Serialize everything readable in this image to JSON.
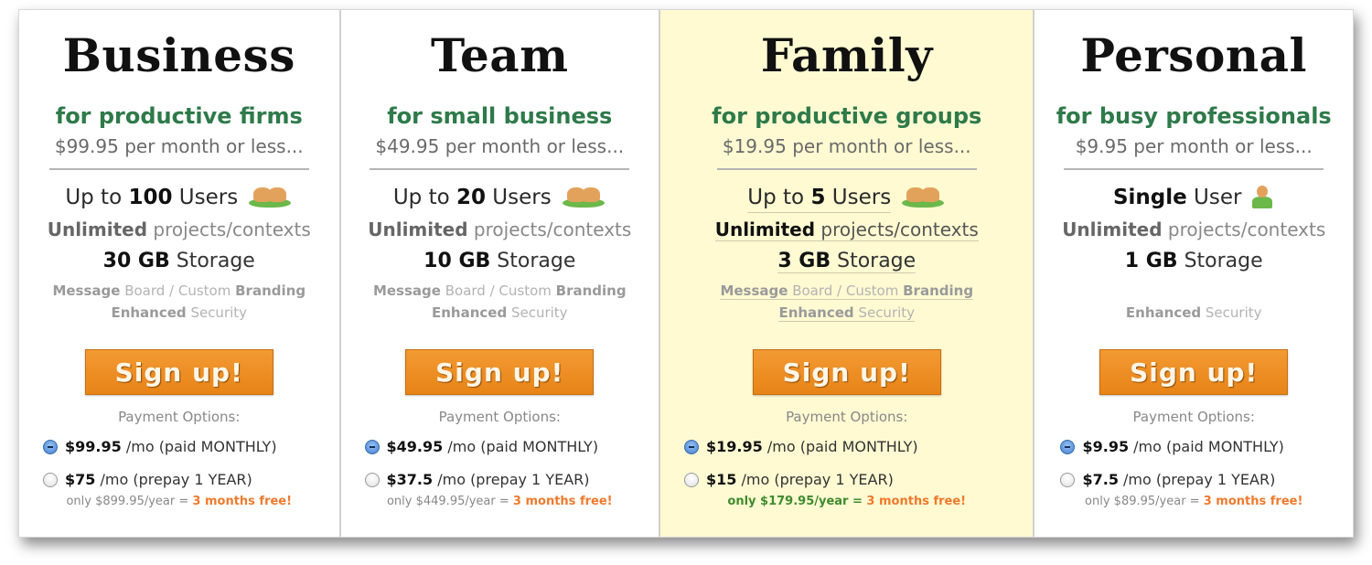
{
  "plans": [
    {
      "name": "Business",
      "tagline": "for productive firms",
      "price_line": "$99.95 per month or less...",
      "users_prefix": "Up to ",
      "users_count": "100",
      "users_suffix": " Users",
      "users_icon": "users-group-icon",
      "projects_bold": "Unlimited",
      "projects_rest": " projects/contexts",
      "storage_bold": "30 GB",
      "storage_rest": " Storage",
      "extras_line1": {
        "a": "Message",
        "b": " Board / Custom ",
        "c": "Branding"
      },
      "extras_line2": {
        "a": "Enhanced",
        "b": " Security"
      },
      "signup_label": "Sign up!",
      "payment_label": "Payment Options:",
      "option_monthly": {
        "price": "$99.95",
        "text": " /mo (paid MONTHLY)",
        "selected": true
      },
      "option_yearly": {
        "price": "$75",
        "text": " /mo (prepay 1 YEAR)",
        "selected": false
      },
      "note_total": "only $899.95/year = ",
      "note_free": "3 months free!",
      "highlighted": false
    },
    {
      "name": "Team",
      "tagline": "for small business",
      "price_line": "$49.95 per month or less...",
      "users_prefix": "Up to ",
      "users_count": "20",
      "users_suffix": " Users",
      "users_icon": "users-group-icon",
      "projects_bold": "Unlimited",
      "projects_rest": " projects/contexts",
      "storage_bold": "10 GB",
      "storage_rest": " Storage",
      "extras_line1": {
        "a": "Message",
        "b": " Board / Custom ",
        "c": "Branding"
      },
      "extras_line2": {
        "a": "Enhanced",
        "b": " Security"
      },
      "signup_label": "Sign up!",
      "payment_label": "Payment Options:",
      "option_monthly": {
        "price": "$49.95",
        "text": " /mo (paid MONTHLY)",
        "selected": true
      },
      "option_yearly": {
        "price": "$37.5",
        "text": " /mo (prepay 1 YEAR)",
        "selected": false
      },
      "note_total": "only $449.95/year = ",
      "note_free": "3 months free!",
      "highlighted": false
    },
    {
      "name": "Family",
      "tagline": "for productive groups",
      "price_line": "$19.95 per month or less...",
      "users_prefix": "Up to ",
      "users_count": "5",
      "users_suffix": " Users",
      "users_icon": "users-group-icon",
      "projects_bold": "Unlimited",
      "projects_rest": " projects/contexts",
      "storage_bold": "3 GB",
      "storage_rest": " Storage",
      "extras_line1": {
        "a": "Message",
        "b": " Board / Custom ",
        "c": "Branding"
      },
      "extras_line2": {
        "a": "Enhanced",
        "b": " Security"
      },
      "signup_label": "Sign up!",
      "payment_label": "Payment Options:",
      "option_monthly": {
        "price": "$19.95",
        "text": " /mo (paid MONTHLY)",
        "selected": true
      },
      "option_yearly": {
        "price": "$15",
        "text": " /mo (prepay 1 YEAR)",
        "selected": false
      },
      "note_total": "only $179.95/year = ",
      "note_free": "3 months free!",
      "highlighted": true,
      "highlight_color": "#fffad2"
    },
    {
      "name": "Personal",
      "tagline": "for busy professionals",
      "price_line": "$9.95 per month or less...",
      "users_bold": "Single",
      "users_suffix": " User",
      "users_icon": "single-user-icon",
      "projects_bold": "Unlimited",
      "projects_rest": " projects/contexts",
      "storage_bold": "1 GB",
      "storage_rest": " Storage",
      "extras_line2": {
        "a": "Enhanced",
        "b": " Security"
      },
      "signup_label": "Sign up!",
      "payment_label": "Payment Options:",
      "option_monthly": {
        "price": "$9.95",
        "text": " /mo (paid MONTHLY)",
        "selected": true
      },
      "option_yearly": {
        "price": "$7.5",
        "text": " /mo (prepay 1 YEAR)",
        "selected": false
      },
      "note_total": "only $89.95/year = ",
      "note_free": "3 months free!",
      "highlighted": false
    }
  ],
  "colors": {
    "tagline_green": "#2e7a4a",
    "signup_orange": "#ec8b22",
    "free_orange": "#ef7a2d",
    "highlight_total_green": "#3f8b2e"
  }
}
